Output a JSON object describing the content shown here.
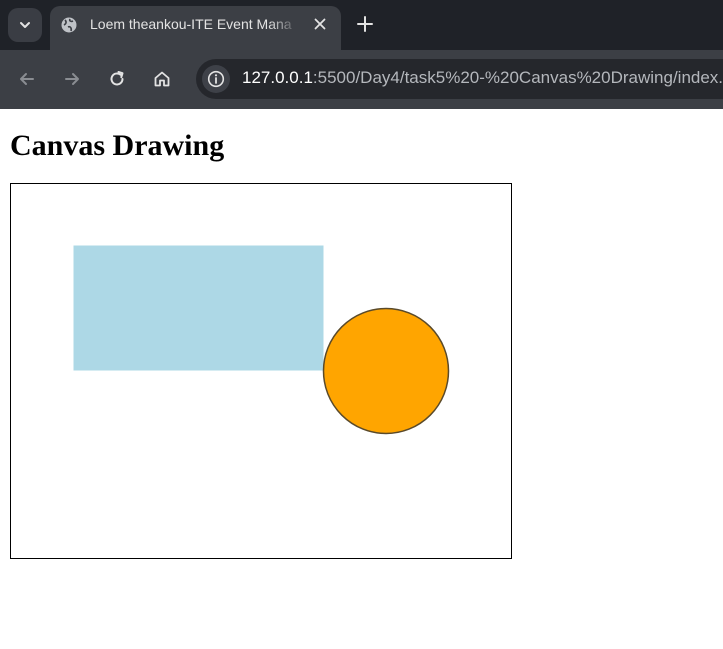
{
  "browser": {
    "tab": {
      "title": "Loem theankou-ITE Event Mana",
      "favicon": "globe-icon"
    },
    "toolbar": {
      "icons": [
        "back-arrow-icon",
        "forward-arrow-icon",
        "reload-icon",
        "home-icon",
        "info-icon"
      ]
    },
    "address_bar": {
      "host": "127.0.0.1",
      "path": ":5500/Day4/task5%20-%20Canvas%20Drawing/index."
    },
    "colors": {
      "tabstrip_bg": "#1f2228",
      "toolbar_bg": "#3c3f45",
      "omnibox_bg": "#25272c"
    }
  },
  "page": {
    "heading": "Canvas Drawing",
    "canvas": {
      "rectangle_fill": "#add8e6",
      "circle_fill": "#ffa500",
      "circle_stroke": "#5a4a2a",
      "border_color": "#000000"
    }
  }
}
